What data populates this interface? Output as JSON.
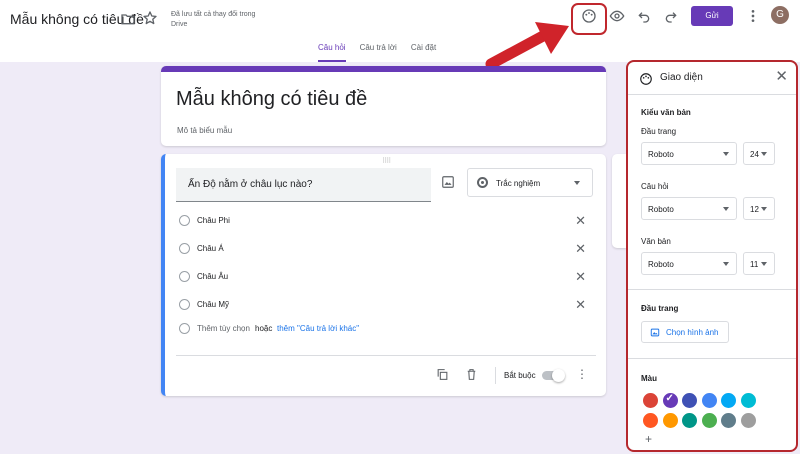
{
  "header": {
    "title": "Mẫu không có tiêu đề",
    "saved_status": "Đã lưu tất cả thay đổi trong Drive",
    "send_label": "Gửi",
    "avatar_letter": "G"
  },
  "tabs": [
    {
      "label": "Câu hỏi",
      "active": true
    },
    {
      "label": "Câu trả lời",
      "active": false
    },
    {
      "label": "Cài đặt",
      "active": false
    }
  ],
  "form": {
    "title": "Mẫu không có tiêu đề",
    "description_placeholder": "Mô tả biểu mẫu"
  },
  "question": {
    "text": "Ấn Độ nằm ở châu lục nào?",
    "type": "Trắc nghiệm",
    "options": [
      "Châu Phi",
      "Châu Á",
      "Châu Âu",
      "Châu Mỹ"
    ],
    "add_option": "Thêm tùy chọn",
    "or": "hoặc",
    "add_other": "thêm \"Câu trả lời khác\"",
    "required_label": "Bắt buộc"
  },
  "theme_panel": {
    "title": "Giao diện",
    "text_style_heading": "Kiểu văn bản",
    "header_label": "Đầu trang",
    "header_font": "Roboto",
    "header_size": "24",
    "question_label": "Câu hỏi",
    "question_font": "Roboto",
    "question_size": "12",
    "body_label": "Văn bản",
    "body_font": "Roboto",
    "body_size": "11",
    "header_section": "Đầu trang",
    "choose_image": "Chọn hình ảnh",
    "color_heading": "Màu",
    "colors_row1": [
      "#db4437",
      "#673ab7",
      "#3f51b5",
      "#4285f4",
      "#03a9f4",
      "#00bcd4"
    ],
    "colors_row2": [
      "#ff5722",
      "#ff9800",
      "#009688",
      "#4caf50",
      "#607d8b",
      "#9e9e9e"
    ],
    "selected_color": "#673ab7"
  }
}
